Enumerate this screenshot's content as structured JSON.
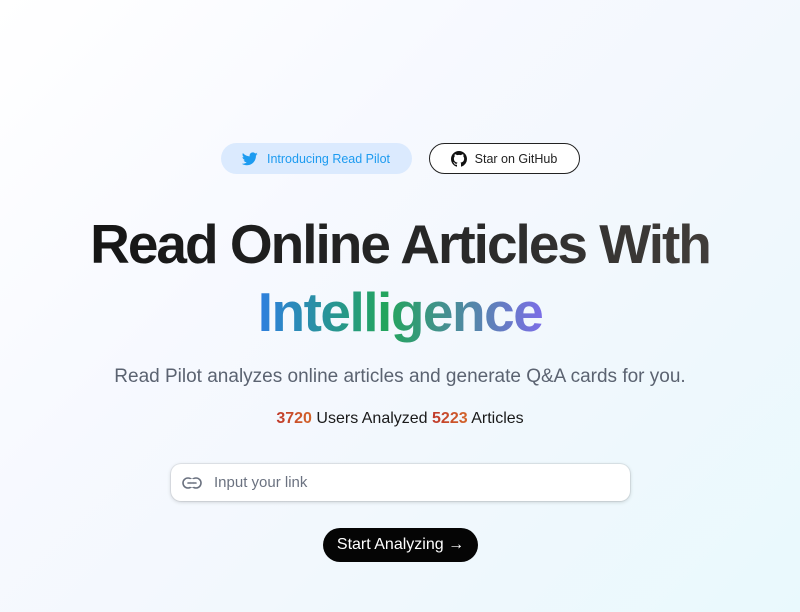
{
  "badges": {
    "twitter": {
      "label": "Introducing Read Pilot",
      "icon": "twitter-icon",
      "color": "#1d9bf0",
      "background": "#dbeafe"
    },
    "github": {
      "label": "Star on GitHub",
      "icon": "github-icon"
    }
  },
  "hero": {
    "title_line1": "Read Online Articles With",
    "title_line2": "Intelligence",
    "subtitle": "Read Pilot analyzes online articles and generate Q&A cards for you."
  },
  "stats": {
    "users_count": "3720",
    "users_label": "Users Analyzed",
    "articles_count": "5223",
    "articles_label": "Articles"
  },
  "link_input": {
    "icon": "link-icon",
    "placeholder": "Input your link",
    "value": ""
  },
  "cta": {
    "label": "Start Analyzing →"
  },
  "colors": {
    "accent_gradient": [
      "#2f7fe0",
      "#23a55c",
      "#7b6ee6"
    ],
    "stat_number": "#c84a2b",
    "cta_background": "#050505"
  }
}
